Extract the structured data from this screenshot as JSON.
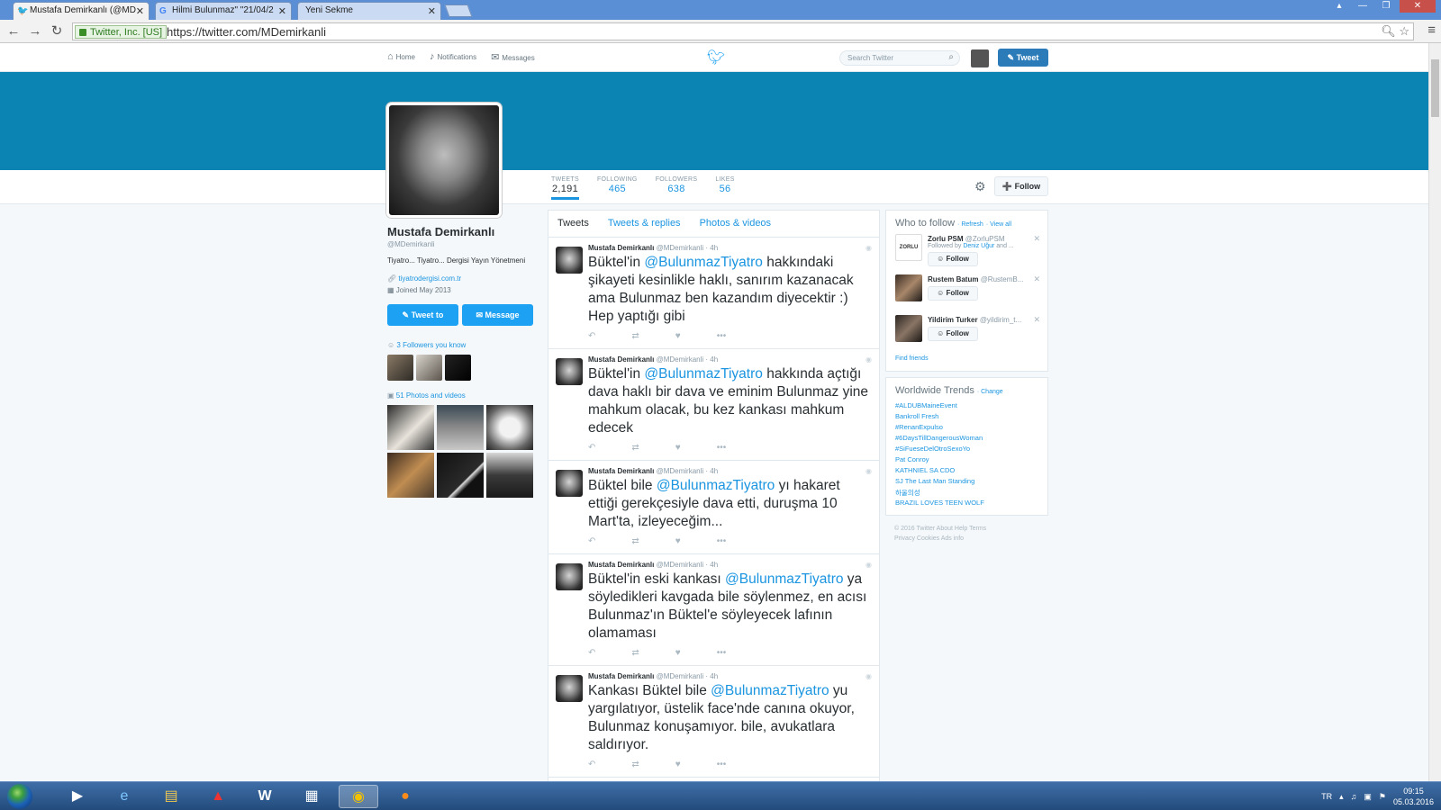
{
  "browser": {
    "tabs": [
      {
        "title": "Mustafa Demirkanlı (@MD",
        "icon": "twitter-icon"
      },
      {
        "title": "Hilmi Bulunmaz\" \"21/04/2",
        "icon": "google-icon"
      },
      {
        "title": "Yeni Sekme",
        "icon": ""
      }
    ],
    "ssl_label": "Twitter, Inc. [US]",
    "url": "https://twitter.com/MDemirkanli"
  },
  "topbar": {
    "nav": [
      "Home",
      "Notifications",
      "Messages"
    ],
    "search_placeholder": "Search Twitter",
    "tweet_button": "Tweet"
  },
  "profile": {
    "stats": [
      {
        "label": "TWEETS",
        "value": "2,191"
      },
      {
        "label": "FOLLOWING",
        "value": "465"
      },
      {
        "label": "FOLLOWERS",
        "value": "638"
      },
      {
        "label": "LIKES",
        "value": "56"
      }
    ],
    "follow_button": "Follow",
    "name": "Mustafa Demirkanlı",
    "handle": "@MDemirkanli",
    "bio": "Tiyatro... Tiyatro... Dergisi Yayın Yönetmeni",
    "link": "tiyatrodergisi.com.tr",
    "joined": "Joined May 2013",
    "tweet_to": "Tweet to",
    "message": "Message",
    "followers_you_know": "3 Followers you know",
    "photos_videos": "51 Photos and videos"
  },
  "timeline": {
    "tabs": [
      "Tweets",
      "Tweets & replies",
      "Photos & videos"
    ],
    "tweets": [
      {
        "name": "Mustafa Demirkanlı",
        "handle": "@MDemirkanli",
        "time": "4h",
        "pre": "Büktel'in ",
        "mention": "@BulunmazTiyatro",
        "post": " hakkındaki şikayeti kesinlikle haklı, sanırım kazanacak ama Bulunmaz ben kazandım diyecektir :) Hep yaptığı gibi"
      },
      {
        "name": "Mustafa Demirkanlı",
        "handle": "@MDemirkanli",
        "time": "4h",
        "pre": "Büktel'in ",
        "mention": "@BulunmazTiyatro",
        "post": " hakkında açtığı dava haklı bir dava ve eminim Bulunmaz yine mahkum olacak, bu kez kankası mahkum edecek"
      },
      {
        "name": "Mustafa Demirkanlı",
        "handle": "@MDemirkanli",
        "time": "4h",
        "pre": "Büktel bile ",
        "mention": "@BulunmazTiyatro",
        "post": " yı hakaret ettiği gerekçesiyle dava etti, duruşma 10 Mart'ta, izleyeceğim..."
      },
      {
        "name": "Mustafa Demirkanlı",
        "handle": "@MDemirkanli",
        "time": "4h",
        "pre": "Büktel'in eski kankası ",
        "mention": "@BulunmazTiyatro",
        "post": " ya söyledikleri kavgada bile söylenmez, en acısı Bulunmaz'ın Büktel'e söyleyecek lafının olamaması"
      },
      {
        "name": "Mustafa Demirkanlı",
        "handle": "@MDemirkanli",
        "time": "4h",
        "pre": "Kankası Büktel bile ",
        "mention": "@BulunmazTiyatro",
        "post": " yu yargılatıyor, üstelik face'nde canına okuyor, Bulunmaz konuşamıyor. bile, avukatlara saldırıyor."
      }
    ]
  },
  "who_to_follow": {
    "title": "Who to follow",
    "refresh": "Refresh",
    "view_all": "View all",
    "users": [
      {
        "name": "Zorlu PSM",
        "handle": "@ZorluPSM",
        "by_prefix": "Followed by",
        "by_user": "Deniz Uğur",
        "by_suffix": "and ...",
        "follow": "Follow"
      },
      {
        "name": "Rustem Batum",
        "handle": "@RustemB...",
        "follow": "Follow"
      },
      {
        "name": "Yildirim Turker",
        "handle": "@yildirim_t...",
        "follow": "Follow"
      }
    ],
    "find_friends": "Find friends"
  },
  "trends": {
    "title": "Worldwide Trends",
    "change": "Change",
    "items": [
      "#ALDUBMaineEvent",
      "Bankroll Fresh",
      "#RenanExpulso",
      "#6DaysTillDangerousWoman",
      "#SiFueseDelOtroSexoYo",
      "Pat Conroy",
      "KATHNIEL SA CDO",
      "SJ The Last Man Standing",
      "하울의성",
      "BRAZIL LOVES TEEN WOLF"
    ]
  },
  "footer": {
    "line1": "© 2016 Twitter   About   Help   Terms",
    "line2": "Privacy   Cookies   Ads info"
  },
  "taskbar": {
    "lang": "TR",
    "time": "09:15",
    "date": "05.03.2016"
  },
  "colors": {
    "banner": "#0b84b4",
    "link": "#1b95e0",
    "button": "#1da1f2"
  }
}
